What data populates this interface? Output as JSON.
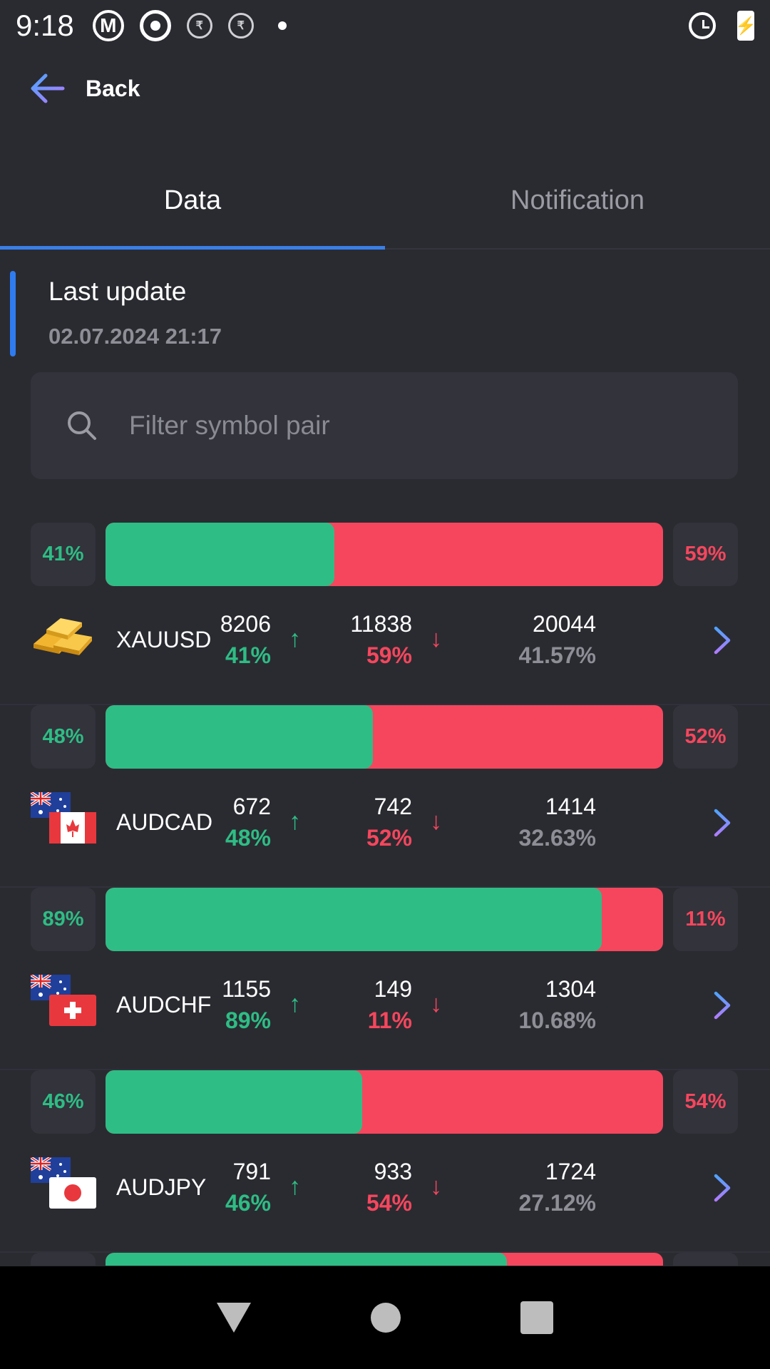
{
  "status": {
    "time": "9:18",
    "icons": [
      "m-icon",
      "target-icon",
      "translate-icon",
      "translate-icon",
      "dot-icon",
      "alarm-icon",
      "battery-charging-icon"
    ]
  },
  "header": {
    "back_label": "Back"
  },
  "tabs": [
    {
      "label": "Data",
      "active": true
    },
    {
      "label": "Notification",
      "active": false
    }
  ],
  "last_update": {
    "title": "Last update",
    "date": "02.07.2024 21:17"
  },
  "search": {
    "placeholder": "Filter symbol pair"
  },
  "colors": {
    "buy": "#2ebd85",
    "sell": "#f6465d",
    "accent": "#3a7fe6",
    "background": "#2a2b31"
  },
  "items": [
    {
      "symbol": "XAUUSD",
      "icon": "gold-bars-icon",
      "buy_ratio": 41,
      "buy_pct_label": "41%",
      "sell_pct_label": "59%",
      "buy_count": "8206",
      "buy_pct": "41%",
      "sell_count": "11838",
      "sell_pct": "59%",
      "total": "20044",
      "total_pct": "41.57%"
    },
    {
      "symbol": "AUDCAD",
      "icon": "flag-au-ca-icon",
      "buy_ratio": 48,
      "buy_pct_label": "48%",
      "sell_pct_label": "52%",
      "buy_count": "672",
      "buy_pct": "48%",
      "sell_count": "742",
      "sell_pct": "52%",
      "total": "1414",
      "total_pct": "32.63%"
    },
    {
      "symbol": "AUDCHF",
      "icon": "flag-au-ch-icon",
      "buy_ratio": 89,
      "buy_pct_label": "89%",
      "sell_pct_label": "11%",
      "buy_count": "1155",
      "buy_pct": "89%",
      "sell_count": "149",
      "sell_pct": "11%",
      "total": "1304",
      "total_pct": "10.68%"
    },
    {
      "symbol": "AUDJPY",
      "icon": "flag-au-jp-icon",
      "buy_ratio": 46,
      "buy_pct_label": "46%",
      "sell_pct_label": "54%",
      "buy_count": "791",
      "buy_pct": "46%",
      "sell_count": "933",
      "sell_pct": "54%",
      "total": "1724",
      "total_pct": "27.12%"
    }
  ],
  "partial_item": {
    "buy_ratio": 72
  }
}
